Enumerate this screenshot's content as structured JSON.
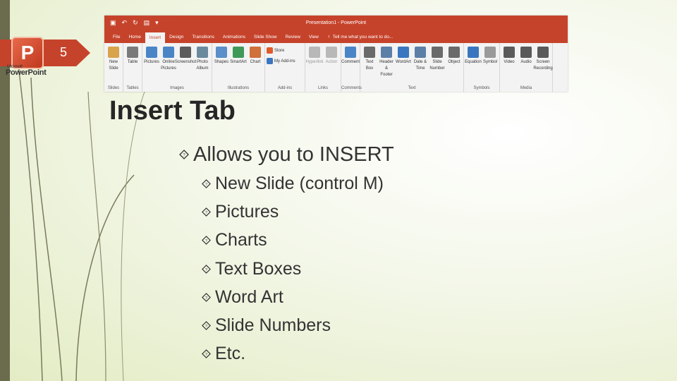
{
  "slide_number": "5",
  "logo": {
    "caption_small": "Microsoft",
    "caption": "PowerPoint",
    "icon": "powerpoint-logo-icon"
  },
  "ribbon": {
    "window_title": "Presentation1 - PowerPoint",
    "tabs": [
      "File",
      "Home",
      "Insert",
      "Design",
      "Transitions",
      "Animations",
      "Slide Show",
      "Review",
      "View"
    ],
    "active_tab": "Insert",
    "tell_me": "Tell me what you want to do...",
    "groups": [
      {
        "label": "Slides",
        "buttons": [
          {
            "label": "New\nSlide",
            "icon": "new-slide-icon",
            "color": "#d8a34a"
          }
        ]
      },
      {
        "label": "Tables",
        "buttons": [
          {
            "label": "Table",
            "icon": "table-icon",
            "color": "#7a7a7a"
          }
        ]
      },
      {
        "label": "Images",
        "buttons": [
          {
            "label": "Pictures",
            "icon": "pictures-icon",
            "color": "#4a86c5"
          },
          {
            "label": "Online\nPictures",
            "icon": "online-pictures-icon",
            "color": "#4a86c5"
          },
          {
            "label": "Screenshot",
            "icon": "screenshot-icon",
            "color": "#5c5c5c"
          },
          {
            "label": "Photo\nAlbum",
            "icon": "photo-album-icon",
            "color": "#6a8a9e"
          }
        ]
      },
      {
        "label": "Illustrations",
        "buttons": [
          {
            "label": "Shapes",
            "icon": "shapes-icon",
            "color": "#5a8fc9"
          },
          {
            "label": "SmartArt",
            "icon": "smartart-icon",
            "color": "#3f9a5a"
          },
          {
            "label": "Chart",
            "icon": "chart-icon",
            "color": "#d0703a"
          }
        ]
      },
      {
        "label": "Add-ins",
        "small": [
          {
            "label": "Store",
            "icon": "store-icon",
            "color": "#e05a2a"
          },
          {
            "label": "My Add-ins",
            "icon": "my-addins-icon",
            "color": "#3a76c0"
          }
        ]
      },
      {
        "label": "Links",
        "gray": true,
        "buttons": [
          {
            "label": "Hyperlink",
            "icon": "hyperlink-icon",
            "color": "#b8b8b8"
          },
          {
            "label": "Action",
            "icon": "action-icon",
            "color": "#b8b8b8"
          }
        ]
      },
      {
        "label": "Comments",
        "buttons": [
          {
            "label": "Comment",
            "icon": "comment-icon",
            "color": "#4a86c5"
          }
        ]
      },
      {
        "label": "Text",
        "buttons": [
          {
            "label": "Text\nBox",
            "icon": "text-box-icon",
            "color": "#6a6a6a"
          },
          {
            "label": "Header\n& Footer",
            "icon": "header-footer-icon",
            "color": "#5c7fa8"
          },
          {
            "label": "WordArt",
            "icon": "wordart-icon",
            "color": "#3a76c0"
          },
          {
            "label": "Date &\nTime",
            "icon": "date-time-icon",
            "color": "#5c7fa8"
          },
          {
            "label": "Slide\nNumber",
            "icon": "slide-number-icon",
            "color": "#6a6a6a"
          },
          {
            "label": "Object",
            "icon": "object-icon",
            "color": "#6a6a6a"
          }
        ]
      },
      {
        "label": "Symbols",
        "buttons": [
          {
            "label": "Equation",
            "icon": "equation-icon",
            "color": "#3a76c0"
          },
          {
            "label": "Symbol",
            "icon": "symbol-icon",
            "color": "#9a9a9a"
          }
        ]
      },
      {
        "label": "Media",
        "buttons": [
          {
            "label": "Video",
            "icon": "video-icon",
            "color": "#5a5a5a"
          },
          {
            "label": "Audio",
            "icon": "audio-icon",
            "color": "#5a5a5a"
          },
          {
            "label": "Screen\nRecording",
            "icon": "screen-recording-icon",
            "color": "#5a5a5a"
          }
        ]
      }
    ]
  },
  "title": "Insert Tab",
  "bullet_main": "Allows you to INSERT",
  "bullets": [
    "New Slide (control M)",
    "Pictures",
    "Charts",
    "Text Boxes",
    "Word Art",
    "Slide Numbers",
    "Etc."
  ],
  "colors": {
    "accent": "#c6432b",
    "text": "#262626",
    "bar": "#6b6b4d"
  }
}
